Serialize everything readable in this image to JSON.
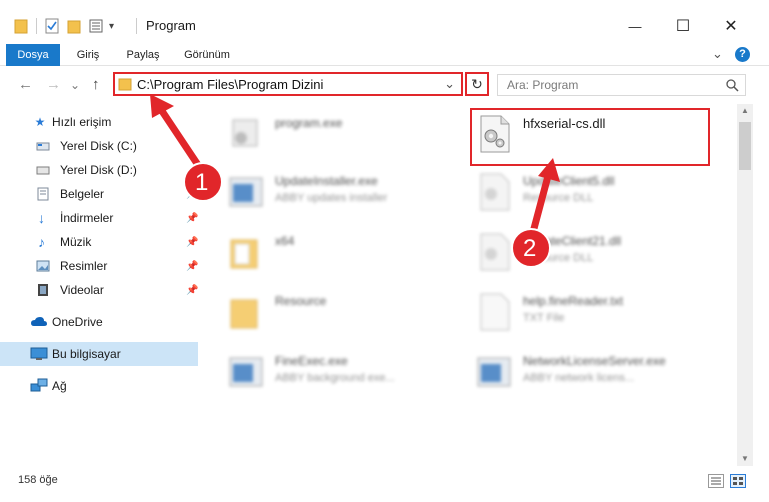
{
  "window": {
    "title": "Program",
    "minimize_glyph": "—",
    "maximize_glyph": "☐",
    "close_glyph": "✕",
    "help_glyph": "?",
    "expand_glyph": "⌄",
    "qa_dropdown_glyph": "▾"
  },
  "ribbon": {
    "tabs": [
      {
        "label": "Dosya"
      },
      {
        "label": "Giriş"
      },
      {
        "label": "Paylaş"
      },
      {
        "label": "Görünüm"
      }
    ]
  },
  "nav": {
    "back_glyph": "←",
    "forward_glyph": "→",
    "history_glyph": "⌄",
    "up_glyph": "↑",
    "address_path": "C:\\Program Files\\Program Dizini",
    "address_dropdown_glyph": "⌄",
    "refresh_glyph": "↻",
    "search_placeholder": "Ara: Program",
    "search_icon": "search-icon"
  },
  "sidebar": {
    "items": [
      {
        "label": "Hızlı erişim",
        "icon": "star-icon",
        "pinned": false
      },
      {
        "label": "Yerel Disk (C:)",
        "icon": "drive-icon",
        "pinned": false
      },
      {
        "label": "Yerel Disk (D:)",
        "icon": "drive-icon",
        "pinned": false
      },
      {
        "label": "Belgeler",
        "icon": "documents-icon",
        "pinned": true
      },
      {
        "label": "İndirmeler",
        "icon": "download-icon",
        "pinned": true
      },
      {
        "label": "Müzik",
        "icon": "music-icon",
        "pinned": true
      },
      {
        "label": "Resimler",
        "icon": "pictures-icon",
        "pinned": true
      },
      {
        "label": "Videolar",
        "icon": "video-icon",
        "pinned": true
      },
      {
        "label": "OneDrive",
        "icon": "cloud-icon",
        "pinned": false
      },
      {
        "label": "Bu bilgisayar",
        "icon": "computer-icon",
        "pinned": false,
        "selected": true
      },
      {
        "label": "Ağ",
        "icon": "network-icon",
        "pinned": false
      }
    ],
    "pin_glyph": "📌"
  },
  "files": [
    {
      "name": "program.exe",
      "sub": "",
      "type": "exe",
      "blurred": true
    },
    {
      "name": "hfxserial-cs.dll",
      "sub": "",
      "type": "dll",
      "blurred": false
    },
    {
      "name": "UpdateInstaller.exe",
      "sub": "ABBY updates installer",
      "type": "exe",
      "blurred": true
    },
    {
      "name": "UpdateClient5.dll",
      "sub": "Resource DLL",
      "type": "dll",
      "blurred": true
    },
    {
      "name": "x64",
      "sub": "",
      "type": "folder",
      "blurred": true
    },
    {
      "name": "UpdateClient21.dll",
      "sub": "Resource DLL",
      "type": "dll",
      "blurred": true
    },
    {
      "name": "Resource",
      "sub": "",
      "type": "folder",
      "blurred": true
    },
    {
      "name": "help.fineReader.txt",
      "sub": "TXT File",
      "type": "txt",
      "blurred": true
    },
    {
      "name": "FineExec.exe",
      "sub": "ABBY background exe...",
      "type": "exe",
      "blurred": true
    },
    {
      "name": "NetworkLicenseServer.exe",
      "sub": "ABBY network licens...",
      "type": "exe",
      "blurred": true
    }
  ],
  "annotations": [
    {
      "label": "1",
      "color": "#e1262a"
    },
    {
      "label": "2",
      "color": "#e1262a"
    }
  ],
  "status": {
    "item_count": "158 öğe"
  }
}
